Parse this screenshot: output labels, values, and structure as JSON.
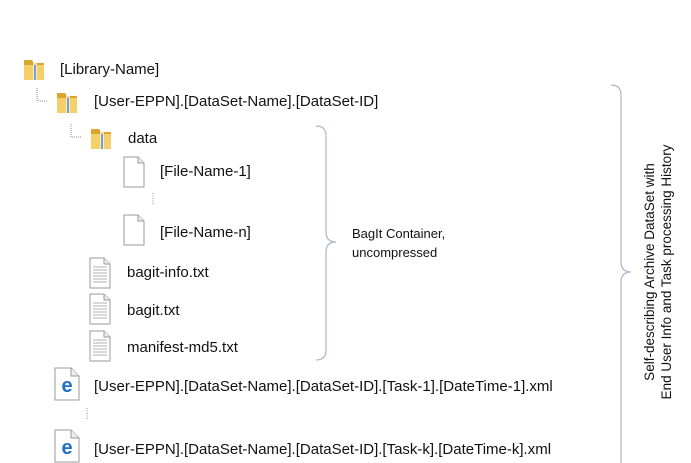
{
  "tree": {
    "library": {
      "label": "[Library-Name]",
      "icon": "folder-icon"
    },
    "dataset_folder": {
      "label": "[User-EPPN].[DataSet-Name].[DataSet-ID]",
      "icon": "folder-icon"
    },
    "data_folder": {
      "label": "data",
      "icon": "folder-icon"
    },
    "files": [
      {
        "label": "[File-Name-1]",
        "icon": "blank-file-icon"
      },
      {
        "label": "[File-Name-n]",
        "icon": "blank-file-icon"
      }
    ],
    "bag_files": [
      {
        "label": "bagit-info.txt",
        "icon": "text-file-icon"
      },
      {
        "label": "bagit.txt",
        "icon": "text-file-icon"
      },
      {
        "label": "manifest-md5.txt",
        "icon": "text-file-icon"
      }
    ],
    "task_files": [
      {
        "label": "[User-EPPN].[DataSet-Name].[DataSet-ID].[Task-1].[DateTime-1].xml",
        "icon": "edge-xml-icon"
      },
      {
        "label": "[User-EPPN].[DataSet-Name].[DataSet-ID].[Task-k].[DateTime-k].xml",
        "icon": "edge-xml-icon"
      }
    ]
  },
  "annotations": {
    "bagit_line1": "BagIt Container,",
    "bagit_line2": "uncompressed",
    "archive_line1": "Self-describing Archive DataSet with",
    "archive_line2": "End User Info and Task processing History"
  },
  "colors": {
    "folder": "#f2c14e",
    "folder_dark": "#d9a52e",
    "edge_blue": "#1f6fc5",
    "line": "#9a9a9a"
  }
}
